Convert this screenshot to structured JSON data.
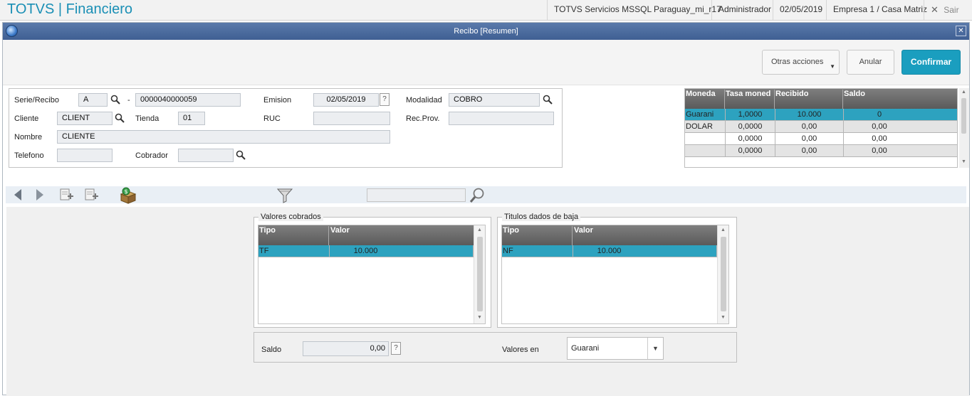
{
  "app": {
    "title": "TOTVS | Financiero",
    "env": "TOTVS Servicios MSSQL Paraguay_mi_r17",
    "user": "Administrador",
    "date": "02/05/2019",
    "company": "Empresa 1 / Casa Matriz",
    "exit_label": "Sair"
  },
  "window": {
    "title": "Recibo [Resumen]",
    "close": "✕"
  },
  "actions": {
    "more": "Otras acciones",
    "cancel": "Anular",
    "confirm": "Confirmar"
  },
  "form": {
    "serie_label": "Serie/Recibo",
    "serie": "A",
    "dash": "-",
    "recibo": "0000040000059",
    "emision_label": "Emision",
    "emision": "02/05/2019",
    "help": "?",
    "modalidad_label": "Modalidad",
    "modalidad": "COBRO",
    "cliente_label": "Cliente",
    "cliente": "CLIENT",
    "tienda_label": "Tienda",
    "tienda": "01",
    "ruc_label": "RUC",
    "ruc": "",
    "recprov_label": "Rec.Prov.",
    "recprov": "",
    "nombre_label": "Nombre",
    "nombre": "CLIENTE",
    "telefono_label": "Telefono",
    "telefono": "",
    "cobrador_label": "Cobrador",
    "cobrador": ""
  },
  "currency_grid": {
    "headers": [
      "Moneda",
      "Tasa moned",
      "Recibido",
      "Saldo"
    ],
    "rows": [
      [
        "Guarani",
        "1,0000",
        "10.000",
        "0"
      ],
      [
        "DOLAR",
        "0,0000",
        "0,00",
        "0,00"
      ],
      [
        "",
        "0,0000",
        "0,00",
        "0,00"
      ],
      [
        "",
        "0,0000",
        "0,00",
        "0,00"
      ]
    ]
  },
  "valores": {
    "title": "Valores cobrados",
    "headers": [
      "Tipo",
      "Valor"
    ],
    "rows": [
      [
        "TF",
        "10.000"
      ]
    ]
  },
  "titulos": {
    "title": "Titulos dados de baja",
    "headers": [
      "Tipo",
      "Valor"
    ],
    "rows": [
      [
        "NF",
        "10.000"
      ]
    ]
  },
  "footer": {
    "saldo_label": "Saldo",
    "saldo": "0,00",
    "help": "?",
    "valores_en_label": "Valores en",
    "valores_en": "Guarani"
  },
  "colors": {
    "accent": "#1a9ebf",
    "selected_row": "#2da2bf",
    "titlebar": "#4a6a9d"
  }
}
